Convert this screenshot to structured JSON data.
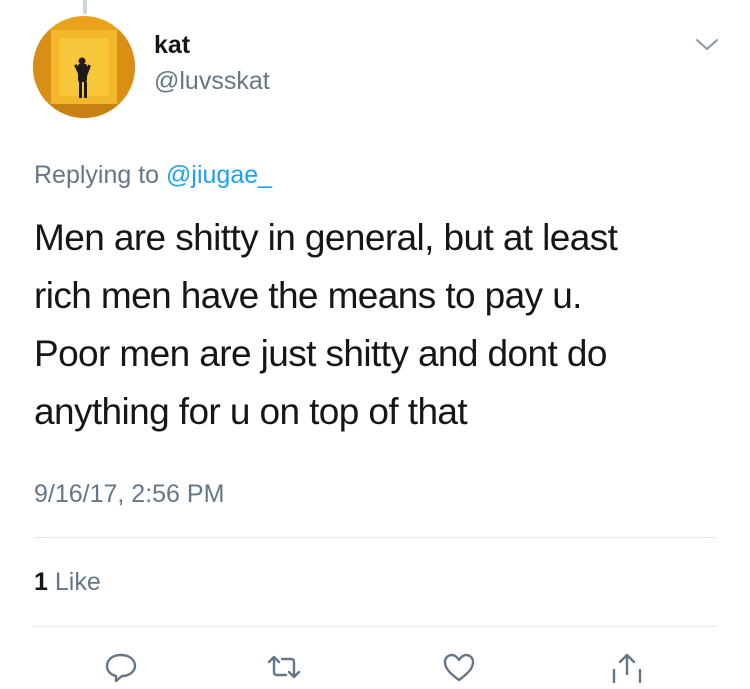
{
  "tweet": {
    "display_name": "kat",
    "handle": "@luvsskat",
    "replying_prefix": "Replying to ",
    "replying_to": "@jiugae_",
    "text_lines": [
      "Men are shitty in general, but at least",
      "rich men have the means to pay u.",
      "Poor men are just shitty and dont do",
      "anything for u on top of that"
    ],
    "timestamp": "9/16/17, 2:56 PM",
    "likes": {
      "count": "1",
      "label": "Like"
    }
  },
  "actions": {
    "reply_icon": "reply-icon",
    "retweet_icon": "retweet-icon",
    "like_icon": "heart-icon",
    "share_icon": "share-icon"
  },
  "colors": {
    "primary_text": "#14171a",
    "secondary_text": "#657786",
    "link": "#1da1f2",
    "divider": "#e1e8ed"
  }
}
